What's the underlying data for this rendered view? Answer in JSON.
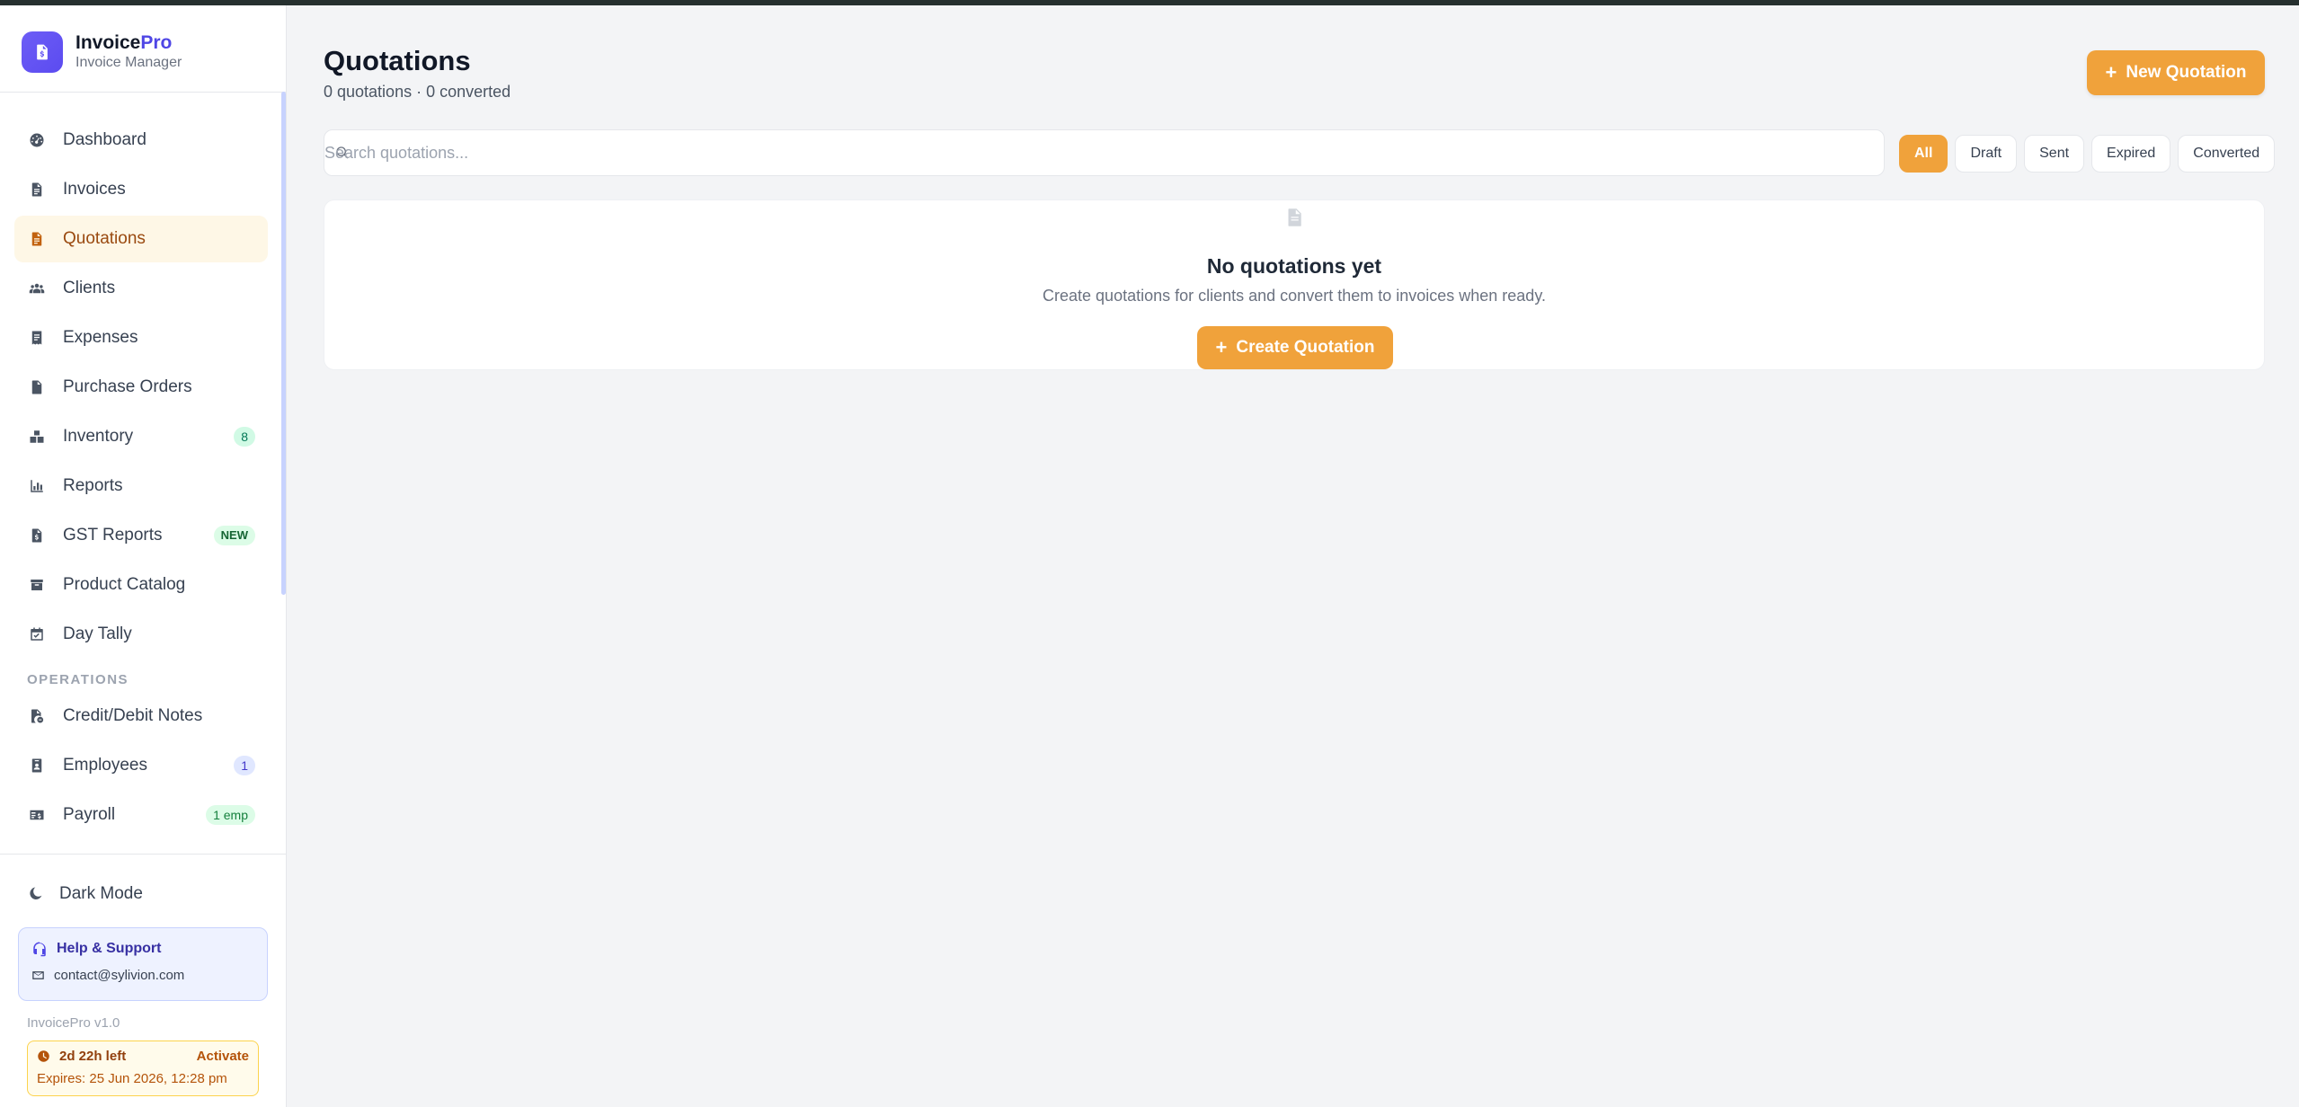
{
  "brand": {
    "name_main": "Invoice",
    "name_accent": "Pro",
    "subtitle": "Invoice Manager"
  },
  "sidebar": {
    "items": [
      {
        "label": "Dashboard",
        "icon": "dashboard-icon"
      },
      {
        "label": "Invoices",
        "icon": "invoice-icon"
      },
      {
        "label": "Quotations",
        "icon": "quotation-icon",
        "active": true
      },
      {
        "label": "Clients",
        "icon": "users-icon"
      },
      {
        "label": "Expenses",
        "icon": "receipt-icon"
      },
      {
        "label": "Purchase Orders",
        "icon": "file-icon"
      },
      {
        "label": "Inventory",
        "icon": "boxes-icon",
        "badge": "8"
      },
      {
        "label": "Reports",
        "icon": "chart-icon"
      },
      {
        "label": "GST Reports",
        "icon": "file-invoice-icon",
        "badge": "NEW"
      },
      {
        "label": "Product Catalog",
        "icon": "box-icon"
      },
      {
        "label": "Day Tally",
        "icon": "calendar-check-icon"
      }
    ],
    "section_operations": "OPERATIONS",
    "ops_items": [
      {
        "label": "Credit/Debit Notes",
        "icon": "file-exchange-icon"
      },
      {
        "label": "Employees",
        "icon": "id-badge-icon",
        "badge": "1"
      },
      {
        "label": "Payroll",
        "icon": "money-check-icon",
        "badge": "1 emp"
      }
    ],
    "dark_mode": "Dark Mode",
    "help": {
      "title": "Help & Support",
      "email": "contact@sylivion.com"
    },
    "version": "InvoicePro v1.0",
    "trial": {
      "left": "2d 22h left",
      "activate": "Activate",
      "expires": "Expires: 25 Jun 2026, 12:28 pm"
    }
  },
  "main": {
    "title": "Quotations",
    "subtitle": "0 quotations · 0 converted",
    "new_button": "New Quotation",
    "search_placeholder": "Search quotations...",
    "filters": [
      "All",
      "Draft",
      "Sent",
      "Expired",
      "Converted"
    ],
    "active_filter": "All",
    "empty": {
      "title": "No quotations yet",
      "description": "Create quotations for clients and convert them to invoices when ready.",
      "button": "Create Quotation"
    }
  },
  "colors": {
    "accent": "#f0a23b",
    "brand": "#5b4bf0",
    "active_bg": "#fef7e6"
  }
}
